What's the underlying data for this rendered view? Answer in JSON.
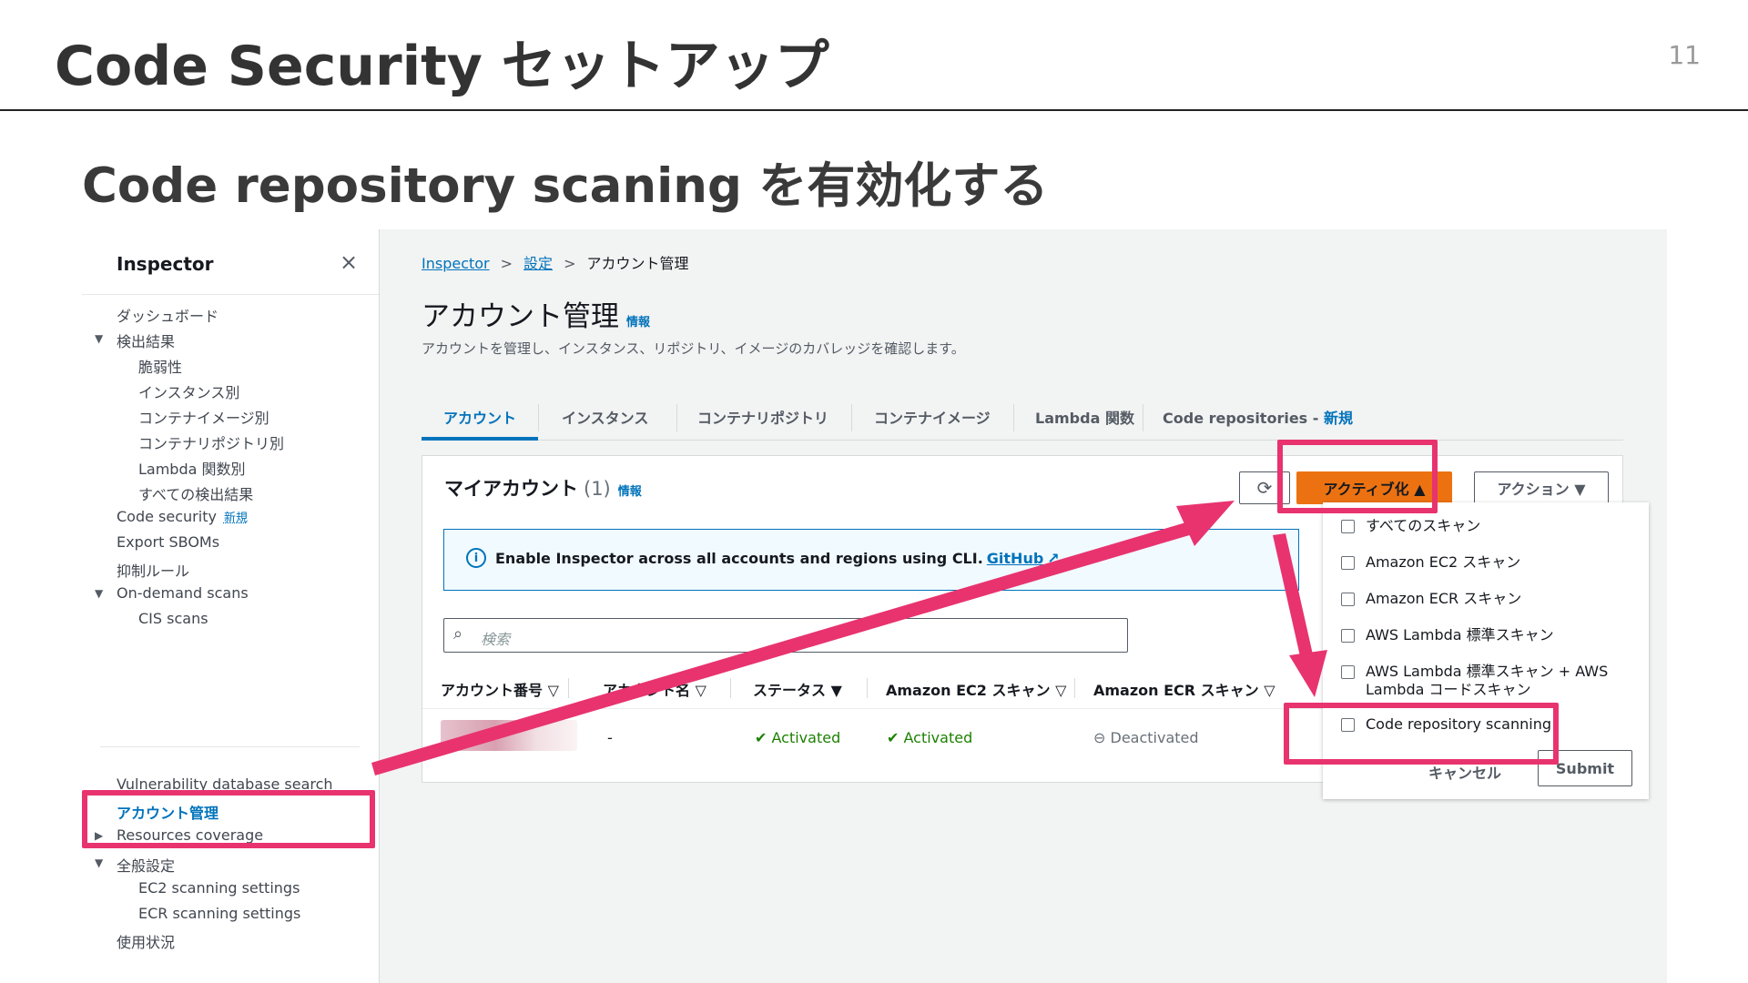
{
  "slide": {
    "title": "Code Security セットアップ",
    "page_number": "11",
    "subtitle": "Code repository scaning を有効化する"
  },
  "sidebar": {
    "title": "Inspector",
    "close_icon": "×",
    "items": [
      {
        "label": "ダッシュボード"
      },
      {
        "label": "検出結果"
      },
      {
        "label": "脆弱性"
      },
      {
        "label": "インスタンス別"
      },
      {
        "label": "コンテナイメージ別"
      },
      {
        "label": "コンテナリポジトリ別"
      },
      {
        "label": "Lambda 関数別"
      },
      {
        "label": "すべての検出結果"
      },
      {
        "label": "Code security",
        "badge": "新規"
      },
      {
        "label": "Export SBOMs"
      },
      {
        "label": "抑制ルール"
      },
      {
        "label": "On-demand scans"
      },
      {
        "label": "CIS scans"
      },
      {
        "label": "Vulnerability database search"
      },
      {
        "label": "アカウント管理"
      },
      {
        "label": "Resources coverage"
      },
      {
        "label": "全般設定"
      },
      {
        "label": "EC2 scanning settings"
      },
      {
        "label": "ECR scanning settings"
      },
      {
        "label": "使用状況"
      }
    ]
  },
  "breadcrumb": {
    "items": [
      "Inspector",
      "設定",
      "アカウント管理"
    ]
  },
  "page": {
    "title": "アカウント管理",
    "info": "情報",
    "description": "アカウントを管理し、インスタンス、リポジトリ、イメージのカバレッジを確認します。"
  },
  "tabs": [
    {
      "label": "アカウント"
    },
    {
      "label": "インスタンス"
    },
    {
      "label": "コンテナリポジトリ"
    },
    {
      "label": "コンテナイメージ"
    },
    {
      "label": "Lambda 関数"
    },
    {
      "label": "Code repositories - ",
      "badge": "新規"
    }
  ],
  "panel": {
    "title": "マイアカウント",
    "count": "(1)",
    "info": "情報",
    "refresh_icon": "⟳",
    "activate_label": "アクティブ化 ▲",
    "action_label": "アクション ▼",
    "alert_text": "Enable Inspector across all accounts and regions using CLI.",
    "alert_link": "GitHub",
    "search_placeholder": "検索"
  },
  "table": {
    "headers": [
      "アカウント番号 ▽",
      "アカウント名 ▽",
      "ステータス ▼",
      "Amazon EC2 スキャン ▽",
      "Amazon ECR スキャン ▽"
    ],
    "row": {
      "account_name": "-",
      "status": "Activated",
      "ec2": "Activated",
      "ecr": "Deactivated"
    }
  },
  "dropdown": {
    "options": [
      "すべてのスキャン",
      "Amazon EC2 スキャン",
      "Amazon ECR スキャン",
      "AWS Lambda 標準スキャン",
      "AWS Lambda 標準スキャン + AWS Lambda コードスキャン",
      "Code repository scanning"
    ],
    "cancel_label": "キャンセル",
    "submit_label": "Submit"
  },
  "colors": {
    "highlight": "#e8336f",
    "accent": "#0073bb",
    "activate_button": "#ec7211",
    "success": "#1d8102"
  }
}
